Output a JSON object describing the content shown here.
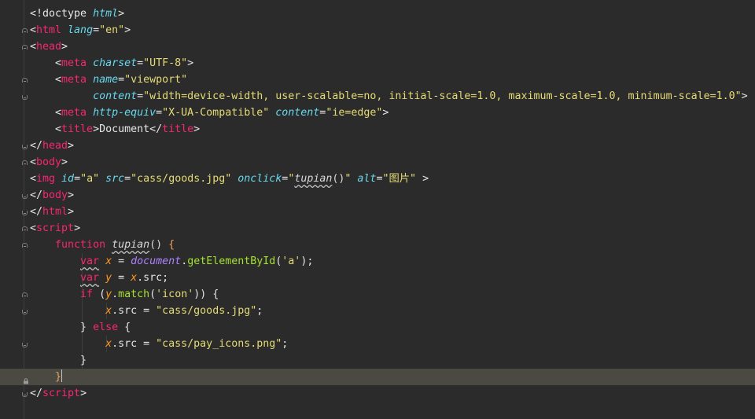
{
  "editor": {
    "lines": [
      {
        "t": [
          {
            "c": "t-br",
            "v": "<!doctype "
          },
          {
            "c": "t-attr",
            "v": "html"
          },
          {
            "c": "t-br",
            "v": ">"
          }
        ]
      },
      {
        "t": [
          {
            "c": "t-br",
            "v": "<"
          },
          {
            "c": "t-tag",
            "v": "html "
          },
          {
            "c": "t-attr",
            "v": "lang"
          },
          {
            "c": "t-br",
            "v": "="
          },
          {
            "c": "t-str",
            "v": "\"en\""
          },
          {
            "c": "t-br",
            "v": ">"
          }
        ]
      },
      {
        "t": [
          {
            "c": "t-br",
            "v": "<"
          },
          {
            "c": "t-tag",
            "v": "head"
          },
          {
            "c": "t-br",
            "v": ">"
          }
        ]
      },
      {
        "t": [
          {
            "c": "t-br",
            "v": "    <"
          },
          {
            "c": "t-tag",
            "v": "meta "
          },
          {
            "c": "t-attr",
            "v": "charset"
          },
          {
            "c": "t-br",
            "v": "="
          },
          {
            "c": "t-str",
            "v": "\"UTF-8\""
          },
          {
            "c": "t-br",
            "v": ">"
          }
        ]
      },
      {
        "t": [
          {
            "c": "t-br",
            "v": "    <"
          },
          {
            "c": "t-tag",
            "v": "meta "
          },
          {
            "c": "t-attr",
            "v": "name"
          },
          {
            "c": "t-br",
            "v": "="
          },
          {
            "c": "t-str",
            "v": "\"viewport\""
          }
        ]
      },
      {
        "t": [
          {
            "c": "t-br",
            "v": "          "
          },
          {
            "c": "t-attr",
            "v": "content"
          },
          {
            "c": "t-br",
            "v": "="
          },
          {
            "c": "t-str",
            "v": "\"width=device-width, user-scalable=no, initial-scale=1.0, maximum-scale=1.0, minimum-scale=1.0\""
          },
          {
            "c": "t-br",
            "v": ">"
          }
        ]
      },
      {
        "t": [
          {
            "c": "t-br",
            "v": "    <"
          },
          {
            "c": "t-tag",
            "v": "meta "
          },
          {
            "c": "t-attr",
            "v": "http-equiv"
          },
          {
            "c": "t-br",
            "v": "="
          },
          {
            "c": "t-str",
            "v": "\"X-UA-Compatible\" "
          },
          {
            "c": "t-attr",
            "v": "content"
          },
          {
            "c": "t-br",
            "v": "="
          },
          {
            "c": "t-str",
            "v": "\"ie=edge\""
          },
          {
            "c": "t-br",
            "v": ">"
          }
        ]
      },
      {
        "t": [
          {
            "c": "t-br",
            "v": "    <"
          },
          {
            "c": "t-tag",
            "v": "title"
          },
          {
            "c": "t-br",
            "v": ">Document</"
          },
          {
            "c": "t-tag",
            "v": "title"
          },
          {
            "c": "t-br",
            "v": ">"
          }
        ]
      },
      {
        "t": [
          {
            "c": "t-br",
            "v": "</"
          },
          {
            "c": "t-tag",
            "v": "head"
          },
          {
            "c": "t-br",
            "v": ">"
          }
        ]
      },
      {
        "t": [
          {
            "c": "t-br",
            "v": "<"
          },
          {
            "c": "t-tag",
            "v": "body"
          },
          {
            "c": "t-br",
            "v": ">"
          }
        ]
      },
      {
        "t": [
          {
            "c": "t-br",
            "v": "<"
          },
          {
            "c": "t-tag",
            "v": "img "
          },
          {
            "c": "t-attr",
            "v": "id"
          },
          {
            "c": "t-br",
            "v": "="
          },
          {
            "c": "t-str",
            "v": "\"a\" "
          },
          {
            "c": "t-attr",
            "v": "src"
          },
          {
            "c": "t-br",
            "v": "="
          },
          {
            "c": "t-str",
            "v": "\"cass/goods.jpg\" "
          },
          {
            "c": "t-attr",
            "v": "onclick"
          },
          {
            "c": "t-br",
            "v": "="
          },
          {
            "c": "t-str",
            "v": "\""
          },
          {
            "c": "t-ident t-ital squig",
            "v": "tupian"
          },
          {
            "c": "t-ident",
            "v": "()"
          },
          {
            "c": "t-str",
            "v": "\" "
          },
          {
            "c": "t-attr",
            "v": "alt"
          },
          {
            "c": "t-br",
            "v": "="
          },
          {
            "c": "t-str",
            "v": "\"图片\" "
          },
          {
            "c": "t-br",
            "v": ">"
          }
        ]
      },
      {
        "t": [
          {
            "c": "t-br",
            "v": "</"
          },
          {
            "c": "t-tag",
            "v": "body"
          },
          {
            "c": "t-br",
            "v": ">"
          }
        ]
      },
      {
        "t": [
          {
            "c": "t-br",
            "v": "</"
          },
          {
            "c": "t-tag",
            "v": "html"
          },
          {
            "c": "t-br",
            "v": ">"
          }
        ]
      },
      {
        "t": [
          {
            "c": "t-br",
            "v": "<"
          },
          {
            "c": "t-tag",
            "v": "script"
          },
          {
            "c": "t-br",
            "v": ">"
          }
        ]
      },
      {
        "t": [
          {
            "c": "t-br",
            "v": "    "
          },
          {
            "c": "t-kw",
            "v": "function "
          },
          {
            "c": "t-ident t-ital squig",
            "v": "tupian"
          },
          {
            "c": "t-ident",
            "v": "() "
          },
          {
            "c": "t-brace",
            "v": "{"
          }
        ]
      },
      {
        "t": [
          {
            "c": "t-br",
            "v": "        "
          },
          {
            "c": "t-kw squig",
            "v": "var"
          },
          {
            "c": "t-br",
            "v": " "
          },
          {
            "c": "t-var",
            "v": "x"
          },
          {
            "c": "t-br",
            "v": " = "
          },
          {
            "c": "t-doc",
            "v": "document"
          },
          {
            "c": "t-br",
            "v": "."
          },
          {
            "c": "t-meth",
            "v": "getElementById"
          },
          {
            "c": "t-br",
            "v": "("
          },
          {
            "c": "t-str",
            "v": "'a'"
          },
          {
            "c": "t-br",
            "v": ");"
          }
        ]
      },
      {
        "t": [
          {
            "c": "t-br",
            "v": "        "
          },
          {
            "c": "t-kw squig",
            "v": "var"
          },
          {
            "c": "t-br",
            "v": " "
          },
          {
            "c": "t-var",
            "v": "y"
          },
          {
            "c": "t-br",
            "v": " = "
          },
          {
            "c": "t-var",
            "v": "x"
          },
          {
            "c": "t-br",
            "v": ".src;"
          }
        ]
      },
      {
        "t": [
          {
            "c": "t-br",
            "v": "        "
          },
          {
            "c": "t-kw",
            "v": "if "
          },
          {
            "c": "t-br",
            "v": "("
          },
          {
            "c": "t-var",
            "v": "y"
          },
          {
            "c": "t-br",
            "v": "."
          },
          {
            "c": "t-meth",
            "v": "match"
          },
          {
            "c": "t-br",
            "v": "("
          },
          {
            "c": "t-str",
            "v": "'icon'"
          },
          {
            "c": "t-br",
            "v": ")) {"
          }
        ]
      },
      {
        "t": [
          {
            "c": "t-br",
            "v": "            "
          },
          {
            "c": "t-var",
            "v": "x"
          },
          {
            "c": "t-br",
            "v": ".src = "
          },
          {
            "c": "t-str",
            "v": "\"cass/goods.jpg\""
          },
          {
            "c": "t-br",
            "v": ";"
          }
        ]
      },
      {
        "t": [
          {
            "c": "t-br",
            "v": "        } "
          },
          {
            "c": "t-kw",
            "v": "else"
          },
          {
            "c": "t-br",
            "v": " {"
          }
        ]
      },
      {
        "t": [
          {
            "c": "t-br",
            "v": "            "
          },
          {
            "c": "t-var",
            "v": "x"
          },
          {
            "c": "t-br",
            "v": ".src = "
          },
          {
            "c": "t-str",
            "v": "\"cass/pay_icons.png\""
          },
          {
            "c": "t-br",
            "v": ";"
          }
        ]
      },
      {
        "t": [
          {
            "c": "t-br",
            "v": "        }"
          }
        ]
      },
      {
        "t": [
          {
            "c": "t-br",
            "v": "    "
          },
          {
            "c": "t-brace",
            "v": "}"
          }
        ],
        "current": true
      },
      {
        "t": [
          {
            "c": "t-br",
            "v": "</"
          },
          {
            "c": "t-tag",
            "v": "script"
          },
          {
            "c": "t-br",
            "v": ">"
          }
        ]
      }
    ]
  },
  "colors": {
    "background": "#2b2b2b",
    "current_line": "#4a4a43",
    "tag": "#f92672",
    "attribute": "#66d9ef",
    "string": "#e6db74",
    "function_name": "#a6e22e"
  }
}
